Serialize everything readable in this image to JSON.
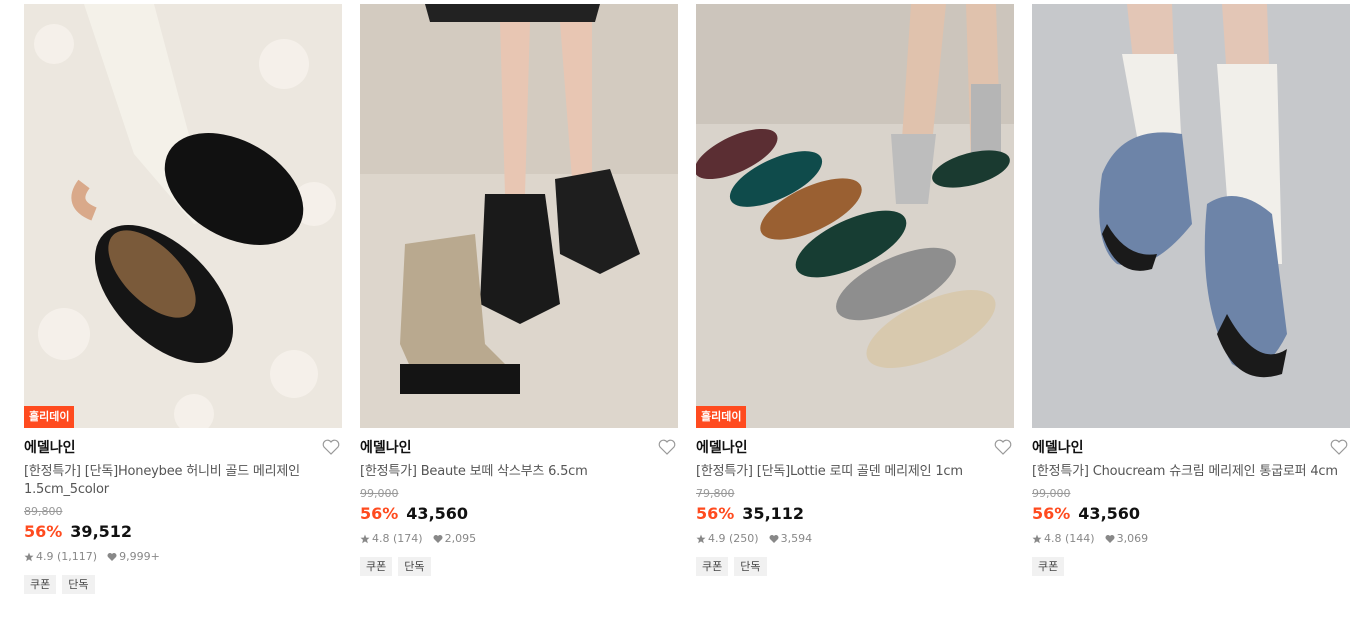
{
  "products": [
    {
      "badge": "홀리데이",
      "brand": "에델나인",
      "title": "[한정특가] [단독]Honeybee 허니비 골드 메리제인 1.5cm_5color",
      "original_price": "89,800",
      "discount": "56%",
      "price": "39,512",
      "rating": "4.9 (1,117)",
      "likes": "9,999+",
      "tags": [
        "쿠폰",
        "단독"
      ]
    },
    {
      "badge": "",
      "brand": "에델나인",
      "title": "[한정특가] Beaute 보떼 삭스부츠 6.5cm",
      "original_price": "99,000",
      "discount": "56%",
      "price": "43,560",
      "rating": "4.8 (174)",
      "likes": "2,095",
      "tags": [
        "쿠폰",
        "단독"
      ]
    },
    {
      "badge": "홀리데이",
      "brand": "에델나인",
      "title": "[한정특가] [단독]Lottie 로띠 골덴 메리제인 1cm",
      "original_price": "79,800",
      "discount": "56%",
      "price": "35,112",
      "rating": "4.9 (250)",
      "likes": "3,594",
      "tags": [
        "쿠폰",
        "단독"
      ]
    },
    {
      "badge": "",
      "brand": "에델나인",
      "title": "[한정특가] Choucream 슈크림 메리제인 통굽로퍼 4cm",
      "original_price": "99,000",
      "discount": "56%",
      "price": "43,560",
      "rating": "4.8 (144)",
      "likes": "3,069",
      "tags": [
        "쿠폰"
      ]
    }
  ],
  "icons": {
    "wishlist": "heart-outline-icon",
    "rating": "star-icon",
    "likes": "heart-filled-icon"
  },
  "colors": {
    "accent": "#ff4b1f",
    "text": "#111111",
    "muted": "#888888",
    "tag_bg": "#f1f1f1"
  }
}
